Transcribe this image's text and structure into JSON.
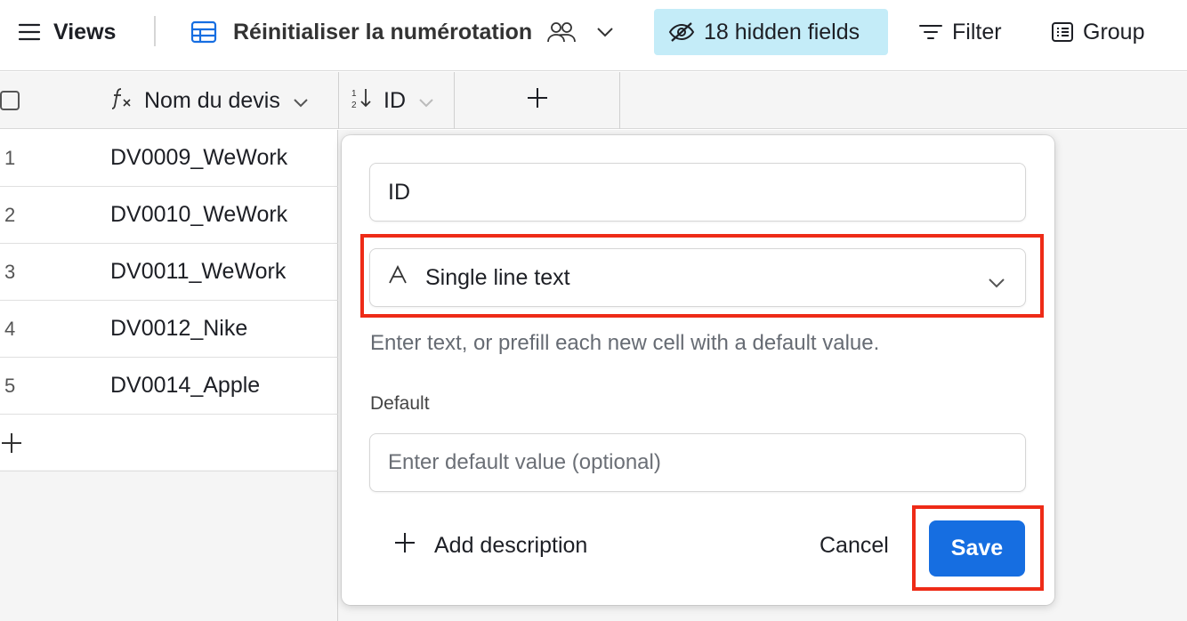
{
  "toolbar": {
    "views_label": "Views",
    "view_name": "Réinitialiser la numérotation",
    "hidden_fields_label": "18 hidden fields",
    "filter_label": "Filter",
    "group_label": "Group",
    "colors": {
      "hidden_fields_bg": "#c4ecf8",
      "grid_icon": "#166ee1"
    }
  },
  "columns": [
    {
      "label": "Nom du devis",
      "icon": "formula-icon"
    },
    {
      "label": "ID",
      "icon": "sort-icon"
    },
    {
      "label": "",
      "icon": "plus-icon"
    }
  ],
  "rows": [
    {
      "num": "1",
      "name": "DV0009_WeWork"
    },
    {
      "num": "2",
      "name": "DV0010_WeWork"
    },
    {
      "num": "3",
      "name": "DV0011_WeWork"
    },
    {
      "num": "4",
      "name": "DV0012_Nike"
    },
    {
      "num": "5",
      "name": "DV0014_Apple"
    }
  ],
  "popover": {
    "field_name_value": "ID",
    "field_type": "Single line text",
    "helper_text": "Enter text, or prefill each new cell with a default value.",
    "default_label": "Default",
    "default_placeholder": "Enter default value (optional)",
    "add_description_label": "Add description",
    "cancel_label": "Cancel",
    "save_label": "Save",
    "colors": {
      "save_bg": "#166ee1",
      "highlight": "#ee2b17"
    }
  }
}
